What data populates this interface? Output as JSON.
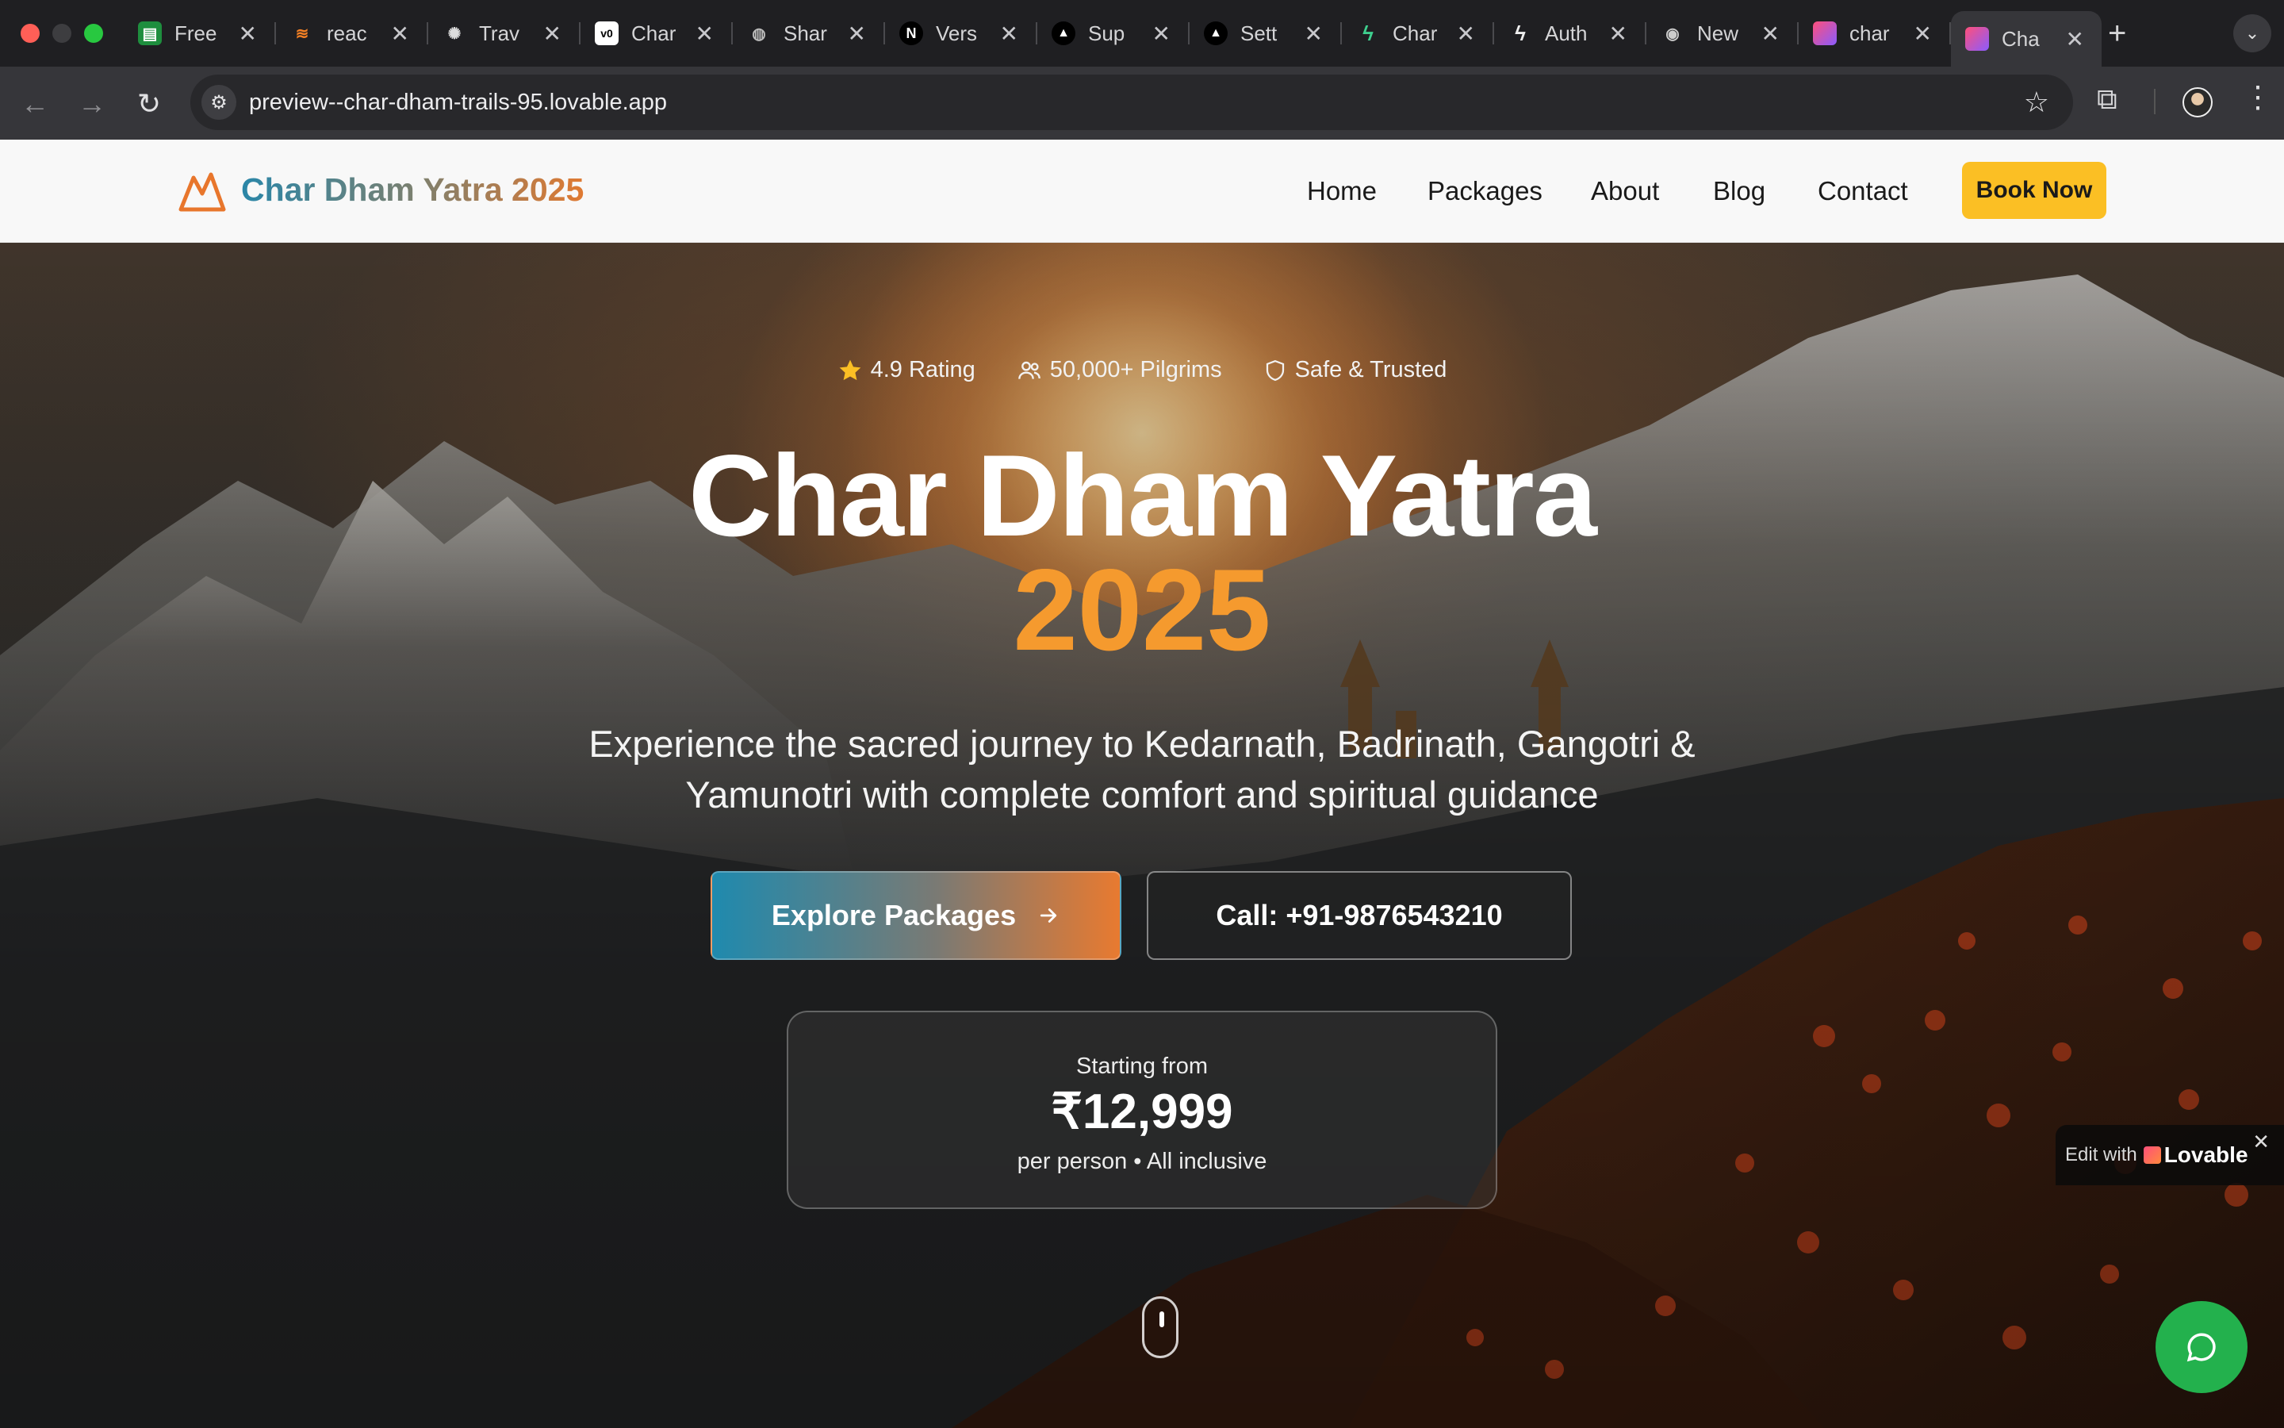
{
  "browser": {
    "tabs": [
      {
        "label": "Free",
        "icon": "sheets-icon"
      },
      {
        "label": "reac",
        "icon": "stackoverflow-icon"
      },
      {
        "label": "Trav",
        "icon": "openai-icon"
      },
      {
        "label": "Char",
        "icon": "v0-icon"
      },
      {
        "label": "Shar",
        "icon": "globe-icon"
      },
      {
        "label": "Vers",
        "icon": "next-icon"
      },
      {
        "label": "Sup",
        "icon": "vercel-icon"
      },
      {
        "label": "Sett",
        "icon": "vercel-icon"
      },
      {
        "label": "Char",
        "icon": "bolt-icon"
      },
      {
        "label": "Auth",
        "icon": "bolt-icon"
      },
      {
        "label": "New",
        "icon": "chrome-icon"
      },
      {
        "label": "char",
        "icon": "lovable-icon"
      },
      {
        "label": "Cha",
        "icon": "lovable-icon"
      }
    ],
    "active_tab_index": 12,
    "url": "preview--char-dham-trails-95.lovable.app"
  },
  "site": {
    "brand": "Char Dham Yatra 2025",
    "nav": [
      "Home",
      "Packages",
      "About",
      "Blog",
      "Contact"
    ],
    "cta": "Book Now"
  },
  "hero": {
    "badges": [
      {
        "icon": "star-icon",
        "label": "4.9 Rating"
      },
      {
        "icon": "users-icon",
        "label": "50,000+ Pilgrims"
      },
      {
        "icon": "shield-icon",
        "label": "Safe & Trusted"
      }
    ],
    "title": "Char Dham Yatra",
    "year": "2025",
    "subtitle_line1": "Experience the sacred journey to Kedarnath, Badrinath, Gangotri &",
    "subtitle_line2": "Yamunotri with complete comfort and spiritual guidance",
    "explore_label": "Explore Packages",
    "call_label": "Call: +91-9876543210",
    "price": {
      "label": "Starting from",
      "amount": "₹12,999",
      "note": "per person • All inclusive"
    }
  },
  "lovable": {
    "edit_label": "Edit with",
    "brand": "Lovable"
  },
  "colors": {
    "accent_orange": "#f59a2e",
    "accent_teal": "#1f8aae",
    "cta_yellow": "#fbbf24",
    "chat_green": "#23b14d"
  }
}
